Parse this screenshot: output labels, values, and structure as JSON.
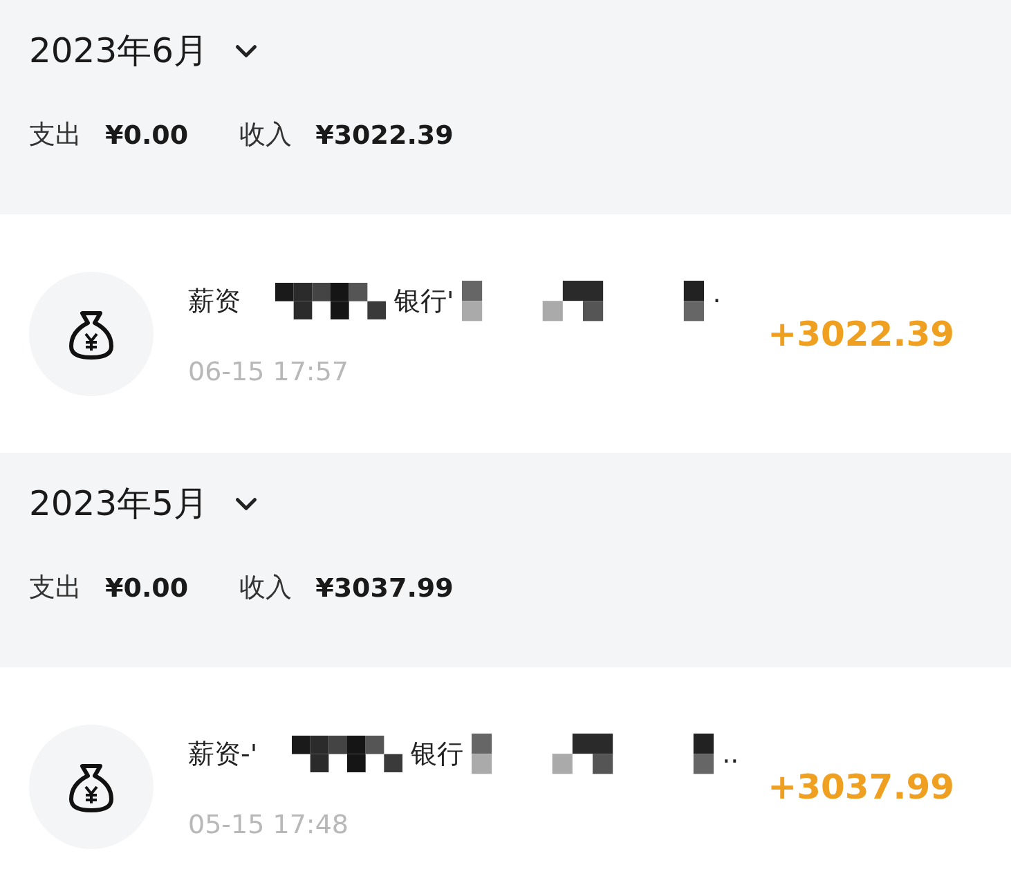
{
  "months": [
    {
      "title": "2023年6月",
      "expanded": true,
      "summary": [
        {
          "label": "支出",
          "amount": "¥0.00"
        },
        {
          "label": "收入",
          "amount": "¥3022.39"
        }
      ],
      "transactions": [
        {
          "title_parts": [
            {
              "kind": "text",
              "text": "薪资"
            },
            {
              "kind": "mosaic"
            },
            {
              "kind": "text",
              "text": "银行'"
            },
            {
              "kind": "mosaic"
            },
            {
              "kind": "text",
              "text": "·"
            }
          ],
          "time": "06-15 17:57",
          "amount": "+3022.39",
          "kind": "income"
        }
      ]
    },
    {
      "title": "2023年5月",
      "expanded": true,
      "summary": [
        {
          "label": "支出",
          "amount": "¥0.00"
        },
        {
          "label": "收入",
          "amount": "¥3037.99"
        }
      ],
      "transactions": [
        {
          "title_parts": [
            {
              "kind": "text",
              "text": "薪资-'"
            },
            {
              "kind": "mosaic"
            },
            {
              "kind": "text",
              "text": "银行"
            },
            {
              "kind": "mosaic"
            },
            {
              "kind": "text",
              "text": ".."
            }
          ],
          "time": "05-15 17:48",
          "amount": "+3037.99",
          "kind": "income"
        }
      ]
    }
  ]
}
